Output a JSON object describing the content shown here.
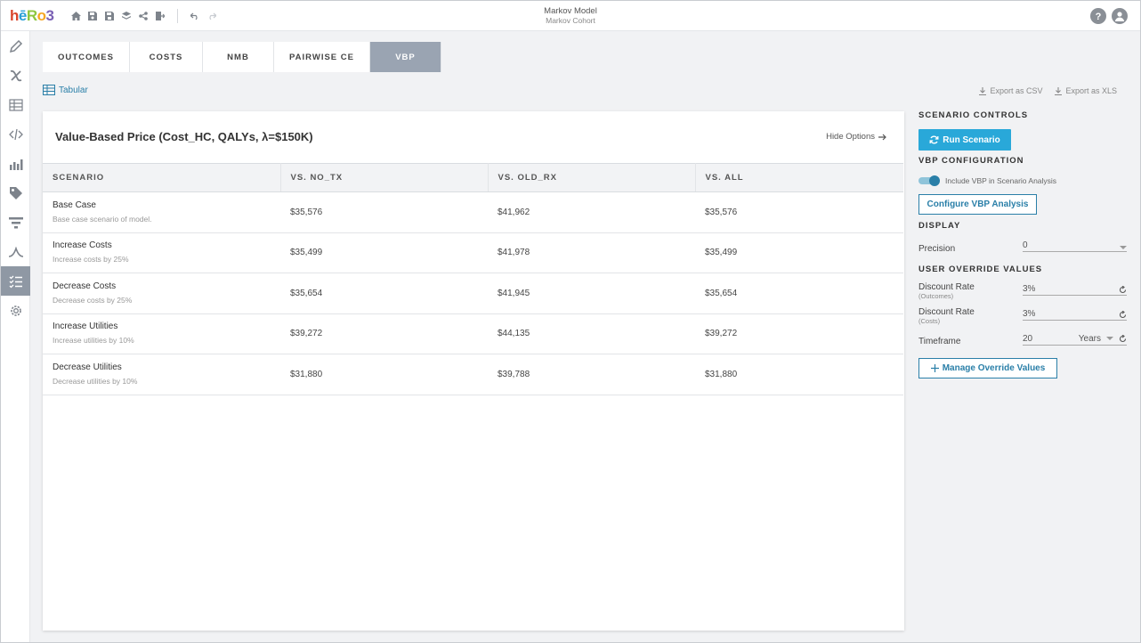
{
  "app": {
    "logo_letters": [
      "h",
      "ē",
      "R",
      "o",
      "3"
    ],
    "logo_colors": [
      "#d9452b",
      "#2a9fd6",
      "#8dc63f",
      "#f5a623",
      "#7b61b5"
    ],
    "title": "Markov Model",
    "subtitle": "Markov Cohort"
  },
  "toolbar": {
    "icons": [
      "home-icon",
      "save-icon",
      "save-as-icon",
      "layers-icon",
      "share-icon",
      "export-icon",
      "undo-icon",
      "redo-icon"
    ],
    "right_icons": [
      "help-icon",
      "user-icon"
    ]
  },
  "sidebar": {
    "items": [
      "pencil-icon",
      "variable-icon",
      "table-icon",
      "code-icon",
      "bar-chart-icon",
      "tag-icon",
      "filter-icon",
      "curve-icon",
      "checklist-icon",
      "settings-icon"
    ],
    "active_index": 8
  },
  "tabs": [
    {
      "label": "OUTCOMES"
    },
    {
      "label": "COSTS"
    },
    {
      "label": "NMB"
    },
    {
      "label": "PAIRWISE CE"
    },
    {
      "label": "VBP"
    }
  ],
  "active_tab": "VBP",
  "view": {
    "tabular_label": "Tabular",
    "export_csv": "Export as CSV",
    "export_xls": "Export as XLS"
  },
  "card": {
    "title": "Value-Based Price (Cost_HC, QALYs, λ=$150K)",
    "hide_options": "Hide Options"
  },
  "table": {
    "columns": [
      "SCENARIO",
      "VS. NO_TX",
      "VS. OLD_RX",
      "VS. ALL"
    ],
    "rows": [
      {
        "name": "Base Case",
        "desc": "Base case scenario of model.",
        "vs_no_tx": "$35,576",
        "vs_old_rx": "$41,962",
        "vs_all": "$35,576"
      },
      {
        "name": "Increase Costs",
        "desc": "Increase costs by 25%",
        "vs_no_tx": "$35,499",
        "vs_old_rx": "$41,978",
        "vs_all": "$35,499"
      },
      {
        "name": "Decrease Costs",
        "desc": "Decrease costs by 25%",
        "vs_no_tx": "$35,654",
        "vs_old_rx": "$41,945",
        "vs_all": "$35,654"
      },
      {
        "name": "Increase Utilities",
        "desc": "Increase utilities by 10%",
        "vs_no_tx": "$39,272",
        "vs_old_rx": "$44,135",
        "vs_all": "$39,272"
      },
      {
        "name": "Decrease Utilities",
        "desc": "Decrease utilities by 10%",
        "vs_no_tx": "$31,880",
        "vs_old_rx": "$39,788",
        "vs_all": "$31,880"
      }
    ]
  },
  "panel": {
    "scenario_controls": "SCENARIO CONTROLS",
    "run_scenario": "Run Scenario",
    "vbp_configuration": "VBP CONFIGURATION",
    "include_vbp": "Include VBP in Scenario Analysis",
    "include_vbp_on": true,
    "configure_vbp": "Configure VBP Analysis",
    "display": "DISPLAY",
    "precision_label": "Precision",
    "precision_value": "0",
    "user_override": "USER OVERRIDE VALUES",
    "discount_outcomes_label": "Discount Rate",
    "discount_outcomes_sub": "(Outcomes)",
    "discount_outcomes_value": "3%",
    "discount_costs_label": "Discount Rate",
    "discount_costs_sub": "(Costs)",
    "discount_costs_value": "3%",
    "timeframe_label": "Timeframe",
    "timeframe_value": "20",
    "timeframe_unit": "Years",
    "manage_override": "Manage Override Values"
  },
  "colors": {
    "accent": "#29a8d9",
    "link": "#2a7fa8",
    "active_tab": "#9aa4b2",
    "active_sidebar": "#8f98a4"
  }
}
